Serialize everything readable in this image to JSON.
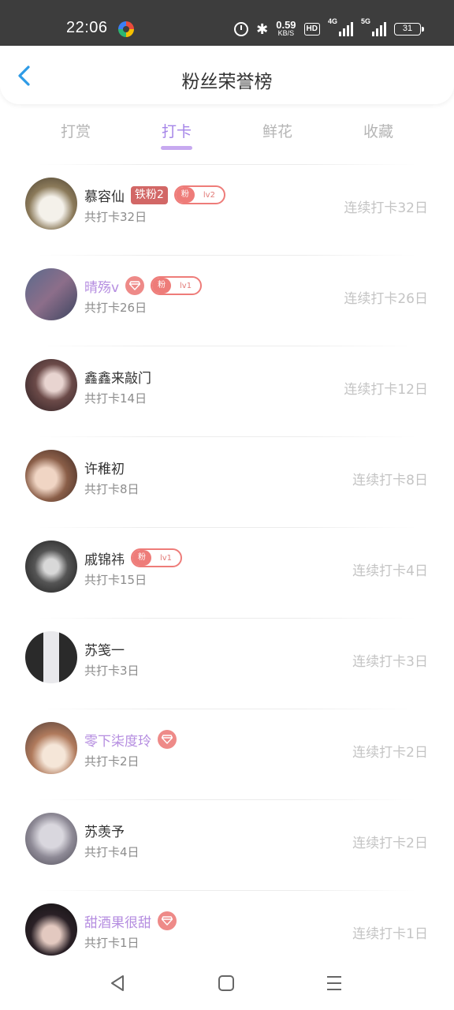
{
  "status_bar": {
    "time": "22:06",
    "net_speed": "0.59",
    "net_unit": "KB/S",
    "hd": "HD",
    "sig1": "4G",
    "sig2": "5G",
    "battery": "31"
  },
  "header": {
    "title": "粉丝荣誉榜",
    "back_icon": "chevron-left-icon"
  },
  "tabs": [
    {
      "label": "打赏",
      "active": false
    },
    {
      "label": "打卡",
      "active": true
    },
    {
      "label": "鲜花",
      "active": false
    },
    {
      "label": "收藏",
      "active": false
    }
  ],
  "colors": {
    "accent": "#a585e8",
    "vip_name": "#b58de0",
    "badge_red": "#d26766",
    "badge_pink": "#ee7c79"
  },
  "fans": [
    {
      "name": "慕容仙",
      "iron": "铁粉2",
      "fen": "粉",
      "lv": "lv2",
      "total": "共打卡32日",
      "streak": "连续打卡32日"
    },
    {
      "name": "晴殇v",
      "vip": true,
      "gem": true,
      "fen": "粉",
      "lv": "lv1",
      "total": "共打卡26日",
      "streak": "连续打卡26日"
    },
    {
      "name": "鑫鑫来敲门",
      "total": "共打卡14日",
      "streak": "连续打卡12日"
    },
    {
      "name": "许稚初",
      "total": "共打卡8日",
      "streak": "连续打卡8日"
    },
    {
      "name": "戚锦祎",
      "fen": "粉",
      "lv": "lv1",
      "total": "共打卡15日",
      "streak": "连续打卡4日"
    },
    {
      "name": "苏笺一",
      "total": "共打卡3日",
      "streak": "连续打卡3日"
    },
    {
      "name": "零下柒度玲",
      "vip": true,
      "gem": true,
      "total": "共打卡2日",
      "streak": "连续打卡2日"
    },
    {
      "name": "苏羡予",
      "total": "共打卡4日",
      "streak": "连续打卡2日"
    },
    {
      "name": "甜酒果很甜",
      "vip": true,
      "gem": true,
      "total": "共打卡1日",
      "streak": "连续打卡1日"
    }
  ],
  "nav_bar": {
    "back": "triangle-back-icon",
    "home": "square-home-icon",
    "menu": "hamburger-menu-icon"
  }
}
